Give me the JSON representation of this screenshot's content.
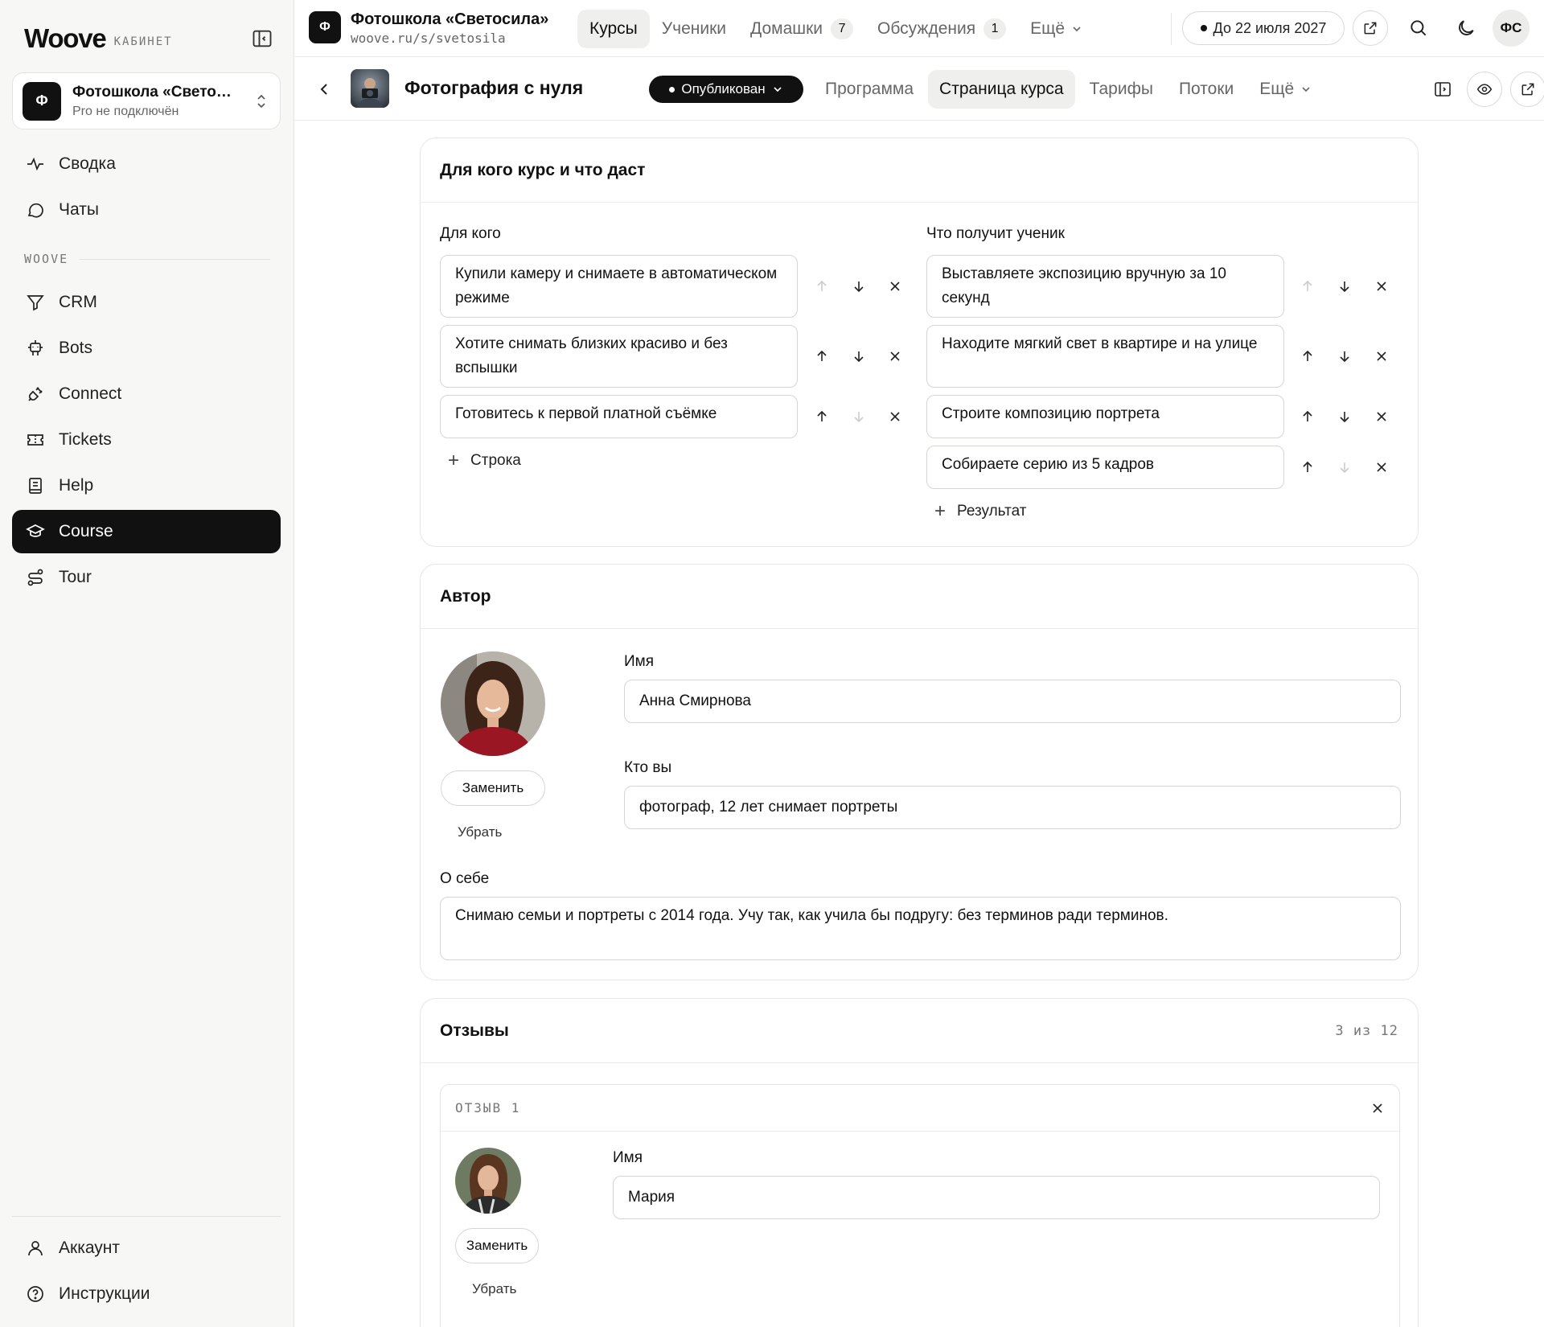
{
  "sidebar": {
    "logo": "Woove",
    "logo_sub": "КАБИНЕТ",
    "org": {
      "avatar": "Ф",
      "name": "Фотошкола «Свето…",
      "status": "Pro не подключён"
    },
    "items_top": [
      {
        "label": "Сводка",
        "icon": "activity-icon"
      },
      {
        "label": "Чаты",
        "icon": "chat-icon"
      }
    ],
    "section_label": "WOOVE",
    "items": [
      {
        "label": "CRM",
        "icon": "funnel-icon"
      },
      {
        "label": "Bots",
        "icon": "bot-icon"
      },
      {
        "label": "Connect",
        "icon": "plug-icon"
      },
      {
        "label": "Tickets",
        "icon": "ticket-icon"
      },
      {
        "label": "Help",
        "icon": "book-icon"
      },
      {
        "label": "Course",
        "icon": "graduation-cap-icon",
        "active": true
      },
      {
        "label": "Tour",
        "icon": "route-icon"
      }
    ],
    "footer": [
      {
        "label": "Аккаунт",
        "icon": "user-icon"
      },
      {
        "label": "Инструкции",
        "icon": "help-circle-icon"
      }
    ]
  },
  "topbar": {
    "site_avatar": "Ф",
    "site_title": "Фотошкола «Светосила»",
    "site_url": "woove.ru/s/svetosila",
    "nav": [
      {
        "label": "Курсы",
        "active": true
      },
      {
        "label": "Ученики"
      },
      {
        "label": "Домашки",
        "badge": "7"
      },
      {
        "label": "Обсуждения",
        "badge": "1"
      },
      {
        "label": "Ещё",
        "dropdown": true
      }
    ],
    "plan": "До 22 июля 2027",
    "user_initials": "ФС"
  },
  "course": {
    "title": "Фотография с нуля",
    "status": "Опубликован",
    "tabs": [
      {
        "label": "Программа"
      },
      {
        "label": "Страница курса",
        "active": true
      },
      {
        "label": "Тарифы"
      },
      {
        "label": "Потоки"
      },
      {
        "label": "Ещё",
        "dropdown": true
      }
    ]
  },
  "audience": {
    "title": "Для кого курс и что даст",
    "for_whom_label": "Для кого",
    "for_whom": [
      "Купили камеру и снимаете в автоматическом режиме",
      "Хотите снимать близких красиво и без вспышки",
      "Готовитесь к первой платной съёмке"
    ],
    "add_row": "Строка",
    "results_label": "Что получит ученик",
    "results": [
      "Выставляете экспозицию вручную за 10 секунд",
      "Находите мягкий свет в квартире и на улице",
      "Строите композицию портрета",
      "Собираете серию из 5 кадров"
    ],
    "add_result": "Результат"
  },
  "author": {
    "title": "Автор",
    "replace": "Заменить",
    "remove": "Убрать",
    "name_label": "Имя",
    "name": "Анна Смирнова",
    "role_label": "Кто вы",
    "role": "фотограф, 12 лет снимает портреты",
    "bio_label": "О себе",
    "bio": "Снимаю семьи и портреты с 2014 года. Учу так, как учила бы подругу: без терминов ради терминов."
  },
  "reviews": {
    "title": "Отзывы",
    "counter": "3 из 12",
    "item_label": "ОТЗЫВ 1",
    "name_label": "Имя",
    "name": "Мария",
    "replace": "Заменить",
    "remove": "Убрать"
  }
}
